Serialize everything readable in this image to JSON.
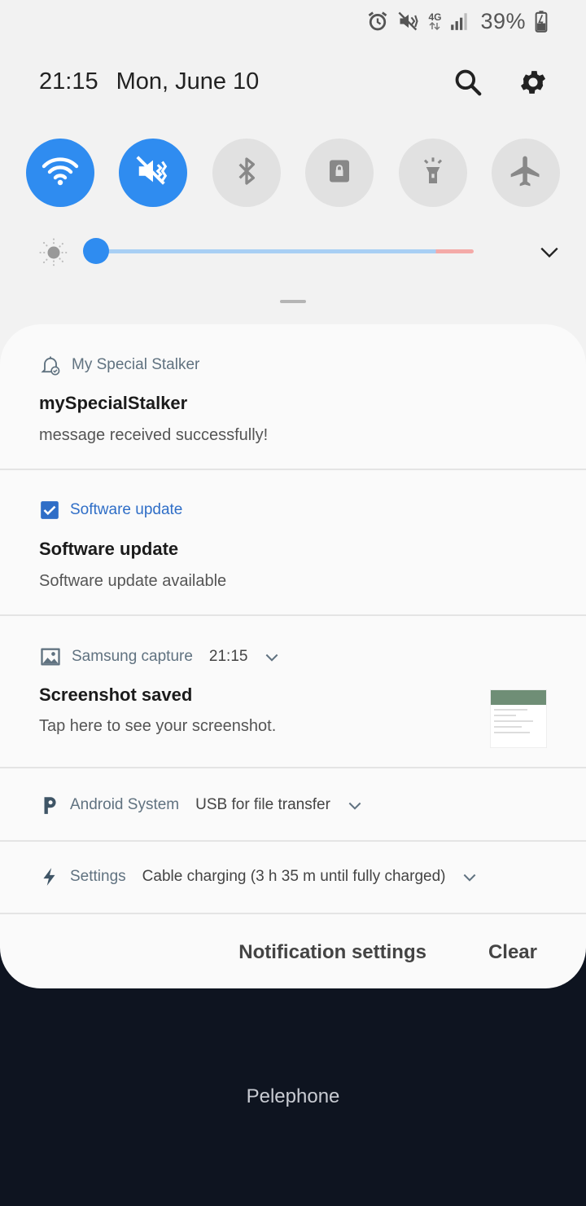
{
  "status_bar": {
    "network": "4G",
    "battery_percent": "39%"
  },
  "header": {
    "time": "21:15",
    "date": "Mon, June 10"
  },
  "quick_toggles": [
    {
      "icon": "wifi-icon",
      "on": true
    },
    {
      "icon": "mute-icon",
      "on": true
    },
    {
      "icon": "bluetooth-icon",
      "on": false
    },
    {
      "icon": "rotation-lock-icon",
      "on": false
    },
    {
      "icon": "flashlight-icon",
      "on": false
    },
    {
      "icon": "airplane-icon",
      "on": false
    }
  ],
  "brightness": {
    "level": 0.0
  },
  "notifications": [
    {
      "app": "My Special Stalker",
      "title": "mySpecialStalker",
      "body": "message received successfully!"
    },
    {
      "app": "Software update",
      "title": "Software update",
      "body": "Software update available"
    },
    {
      "app": "Samsung capture",
      "time": "21:15",
      "title": "Screenshot saved",
      "body": "Tap here to see your screenshot."
    },
    {
      "app": "Android System",
      "summary": "USB for file transfer"
    },
    {
      "app": "Settings",
      "summary": "Cable charging (3 h 35 m until fully charged)"
    }
  ],
  "footer": {
    "notification_settings_label": "Notification settings",
    "clear_label": "Clear"
  },
  "carrier": "Pelephone",
  "colors": {
    "accent": "#2f8cf0",
    "panel_bg": "#f2f2f2",
    "lock_bg": "#0e1420"
  }
}
